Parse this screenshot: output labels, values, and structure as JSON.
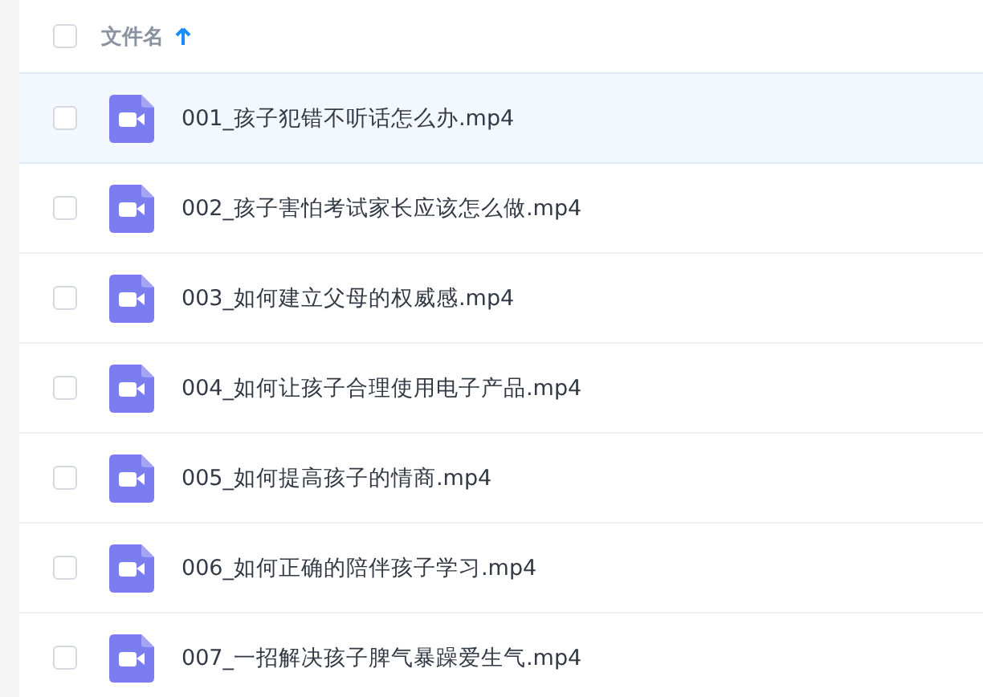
{
  "header": {
    "checked": false,
    "column_label": "文件名",
    "ascending": true
  },
  "files": [
    {
      "name": "001_孩子犯错不听话怎么办.mp4",
      "checked": false,
      "highlighted": true
    },
    {
      "name": "002_孩子害怕考试家长应该怎么做.mp4",
      "checked": false,
      "highlighted": false
    },
    {
      "name": "003_如何建立父母的权威感.mp4",
      "checked": false,
      "highlighted": false
    },
    {
      "name": "004_如何让孩子合理使用电子产品.mp4",
      "checked": false,
      "highlighted": false
    },
    {
      "name": "005_如何提高孩子的情商.mp4",
      "checked": false,
      "highlighted": false
    },
    {
      "name": "006_如何正确的陪伴孩子学习.mp4",
      "checked": false,
      "highlighted": false
    },
    {
      "name": "007_一招解决孩子脾气暴躁爱生气.mp4",
      "checked": false,
      "highlighted": false
    }
  ]
}
